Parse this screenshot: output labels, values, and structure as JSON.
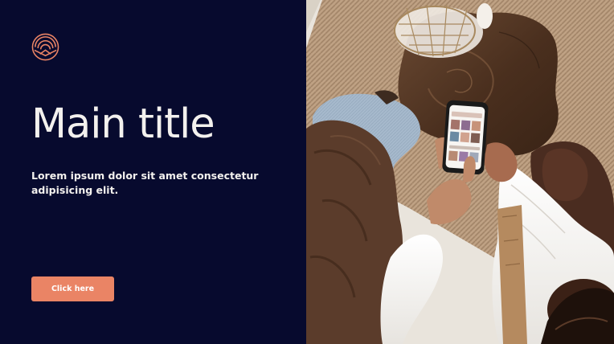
{
  "hero": {
    "title": "Main title",
    "subtitle": "Lorem ipsum dolor sit amet consectetur adipisicing elit.",
    "cta_label": "Click here"
  },
  "icons": {
    "logo": "mountain-sun-arch-logo"
  },
  "colors": {
    "background": "#070a2e",
    "text": "#f3f1ee",
    "accent": "#ea8465"
  }
}
